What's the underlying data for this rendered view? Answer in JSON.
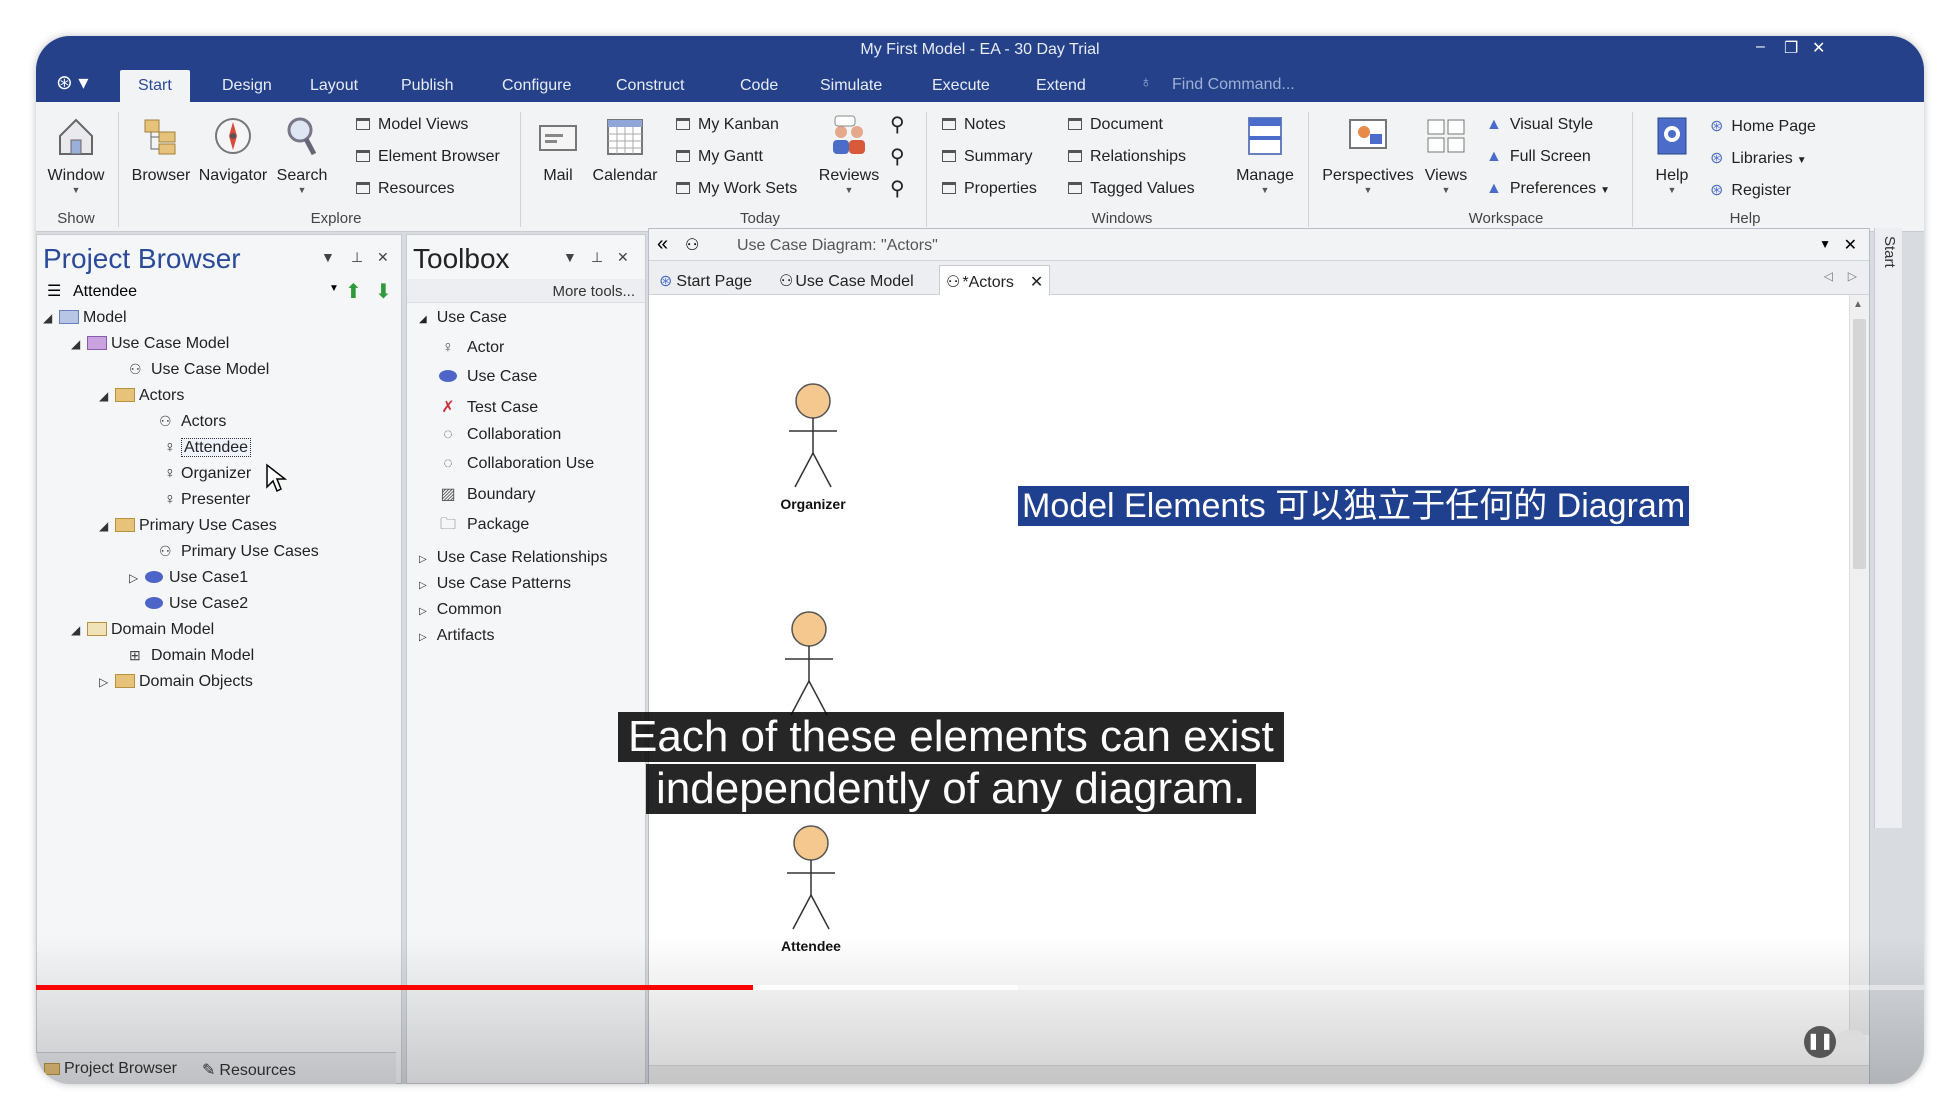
{
  "window": {
    "title": "My First Model - EA - 30 Day Trial"
  },
  "menu": {
    "tabs": [
      "Start",
      "Design",
      "Layout",
      "Publish",
      "Configure",
      "Construct",
      "Code",
      "Simulate",
      "Execute",
      "Extend"
    ],
    "active": "Start",
    "find_placeholder": "Find Command..."
  },
  "ribbon": {
    "show": {
      "window": "Window",
      "group": "Show"
    },
    "explore": {
      "browser": "Browser",
      "navigator": "Navigator",
      "search": "Search",
      "model_views": "Model Views",
      "element_browser": "Element Browser",
      "resources": "Resources",
      "group": "Explore"
    },
    "today": {
      "mail": "Mail",
      "calendar": "Calendar",
      "my_kanban": "My Kanban",
      "my_gantt": "My Gantt",
      "my_work_sets": "My Work Sets",
      "reviews": "Reviews",
      "group": "Today"
    },
    "windows": {
      "notes": "Notes",
      "summary": "Summary",
      "properties": "Properties",
      "document": "Document",
      "relationships": "Relationships",
      "tagged_values": "Tagged Values",
      "manage": "Manage",
      "group": "Windows"
    },
    "workspace": {
      "perspectives": "Perspectives",
      "views": "Views",
      "visual_style": "Visual Style",
      "full_screen": "Full Screen",
      "preferences": "Preferences",
      "group": "Workspace"
    },
    "help": {
      "help": "Help",
      "home_page": "Home Page",
      "libraries": "Libraries",
      "register": "Register",
      "group": "Help"
    }
  },
  "project_browser": {
    "title": "Project Browser",
    "selected": "Attendee",
    "tree": [
      {
        "label": "Model"
      },
      {
        "label": "Use Case Model"
      },
      {
        "label": "Use Case Model"
      },
      {
        "label": "Actors"
      },
      {
        "label": "Actors"
      },
      {
        "label": "Attendee"
      },
      {
        "label": "Organizer"
      },
      {
        "label": "Presenter"
      },
      {
        "label": "Primary Use Cases"
      },
      {
        "label": "Primary Use Cases"
      },
      {
        "label": "Use Case1"
      },
      {
        "label": "Use Case2"
      },
      {
        "label": "Domain Model"
      },
      {
        "label": "Domain Model"
      },
      {
        "label": "Domain Objects"
      }
    ],
    "bottom_tabs": [
      "Project Browser",
      "Resources"
    ]
  },
  "toolbox": {
    "title": "Toolbox",
    "more_tools": "More tools...",
    "section": "Use Case",
    "items": [
      "Actor",
      "Use Case",
      "Test Case",
      "Collaboration",
      "Collaboration Use",
      "Boundary",
      "Package"
    ],
    "groups": [
      "Use Case Relationships",
      "Use Case Patterns",
      "Common",
      "Artifacts"
    ]
  },
  "diagram": {
    "header": "Use Case Diagram: \"Actors\"",
    "tabs": [
      "Start Page",
      "Use Case Model",
      "*Actors"
    ],
    "actors": [
      "Organizer",
      "Attendee"
    ],
    "callout": "Model Elements 可以独立于任何的 Diagram",
    "side_label": "Start"
  },
  "caption": {
    "line1": "Each of these elements can exist",
    "line2": "independently of any diagram."
  },
  "player": {
    "progress": 0.38,
    "buffered": 0.52
  }
}
